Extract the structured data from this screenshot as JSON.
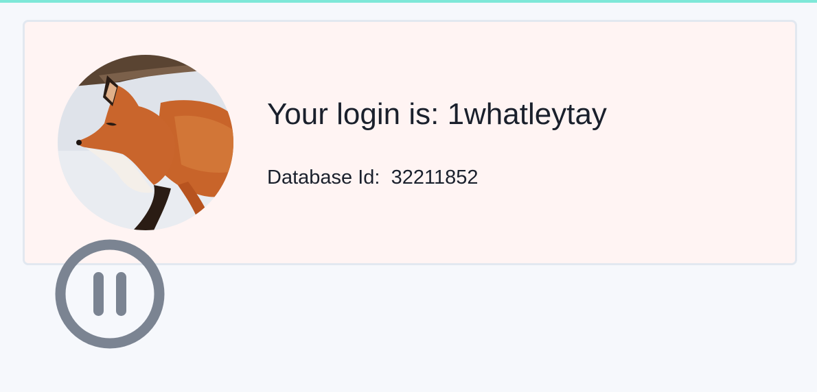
{
  "colors": {
    "top_accent": "#7ee8d8",
    "card_background": "#fff4f3",
    "card_border": "#e2e8f0",
    "text": "#1a202c",
    "pause_icon": "#7b8492"
  },
  "profile": {
    "login_label": "Your login is:",
    "login_value": "1whatleytay",
    "database_label": "Database Id:",
    "database_value": "32211852",
    "avatar_icon": "fox-photo"
  },
  "controls": {
    "pause_icon": "pause-circle-icon"
  }
}
